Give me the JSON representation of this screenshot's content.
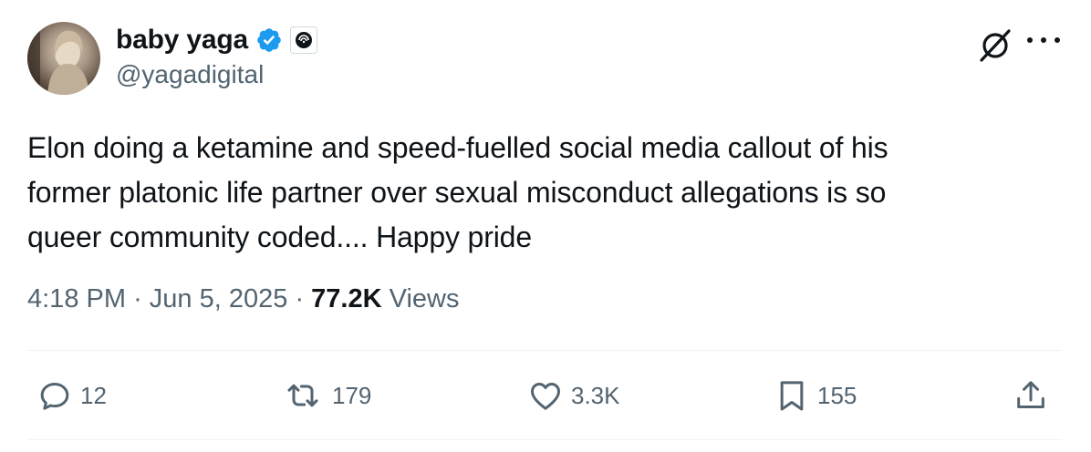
{
  "user": {
    "display_name": "baby yaga",
    "handle": "@yagadigital",
    "verified": true,
    "avatar_icon": "avatar-image"
  },
  "tweet": {
    "text": "Elon doing a ketamine and speed-fuelled social media callout of his\nformer platonic life partner over sexual misconduct allegations is so\nqueer community coded.... Happy pride"
  },
  "meta": {
    "time": "4:18 PM",
    "separator": "·",
    "date": "Jun 5, 2025",
    "views_count": "77.2K",
    "views_label": "Views"
  },
  "actions": {
    "replies": "12",
    "reposts": "179",
    "likes": "3.3K",
    "bookmarks": "155"
  },
  "colors": {
    "verified_blue": "#1d9bf0",
    "text_primary": "#0f1419",
    "text_secondary": "#536471",
    "divider": "#eff3f4"
  }
}
